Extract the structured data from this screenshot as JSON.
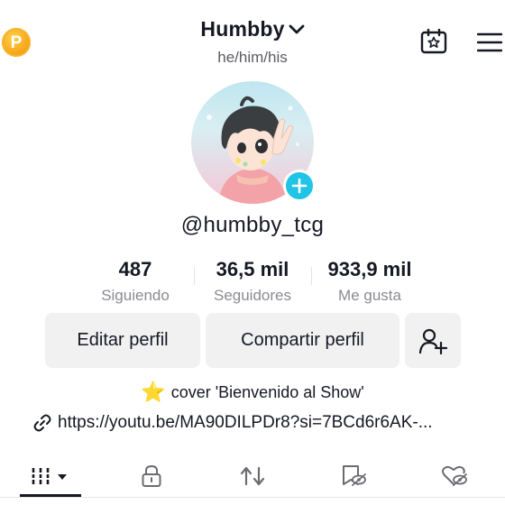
{
  "header": {
    "coin_label": "P",
    "username": "Humbby",
    "pronouns": "he/him/his"
  },
  "profile": {
    "handle": "@humbby_tcg"
  },
  "stats": [
    {
      "value": "487",
      "label": "Siguiendo"
    },
    {
      "value": "36,5 mil",
      "label": "Seguidores"
    },
    {
      "value": "933,9 mil",
      "label": "Me gusta"
    }
  ],
  "actions": {
    "edit_profile": "Editar perfil",
    "share_profile": "Compartir perfil"
  },
  "bio": {
    "emoji": "⭐",
    "text": "cover 'Bienvenido al Show'"
  },
  "link": {
    "url": "https://youtu.be/MA90DILPDr8?si=7BCd6r6AK-..."
  },
  "tabs": [
    {
      "icon": "grid-icon",
      "active": true
    },
    {
      "icon": "lock-icon",
      "active": false
    },
    {
      "icon": "repost-icon",
      "active": false
    },
    {
      "icon": "bookmark-hidden-icon",
      "active": false
    },
    {
      "icon": "liked-hidden-icon",
      "active": false
    }
  ],
  "colors": {
    "accent_add": "#20c4e6",
    "coin": "#f6a61c",
    "text": "#161823",
    "muted": "#8a8b91"
  }
}
